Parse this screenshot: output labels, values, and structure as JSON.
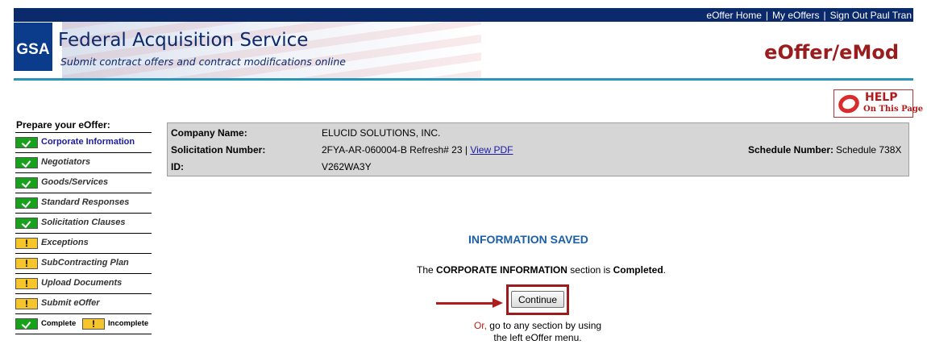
{
  "topnav": {
    "links": [
      "eOffer Home",
      "My eOffers",
      "Sign Out Paul Tran"
    ],
    "separator": "|"
  },
  "header": {
    "logo_text": "GSA",
    "title": "Federal Acquisition Service",
    "subtitle": "Submit contract offers and contract modifications online",
    "app_name": "eOffer/eMod"
  },
  "help": {
    "line1": "HELP",
    "line2": "On This Page"
  },
  "menu": {
    "title": "Prepare your eOffer:",
    "items": [
      {
        "label": "Corporate Information",
        "status": "complete",
        "active": true
      },
      {
        "label": "Negotiators",
        "status": "complete",
        "active": false
      },
      {
        "label": "Goods/Services",
        "status": "complete",
        "active": false
      },
      {
        "label": "Standard Responses",
        "status": "complete",
        "active": false
      },
      {
        "label": "Solicitation Clauses",
        "status": "complete",
        "active": false
      },
      {
        "label": "Exceptions",
        "status": "incomplete",
        "active": false
      },
      {
        "label": "SubContracting Plan",
        "status": "incomplete",
        "active": false
      },
      {
        "label": "Upload Documents",
        "status": "incomplete",
        "active": false
      },
      {
        "label": "Submit eOffer",
        "status": "incomplete",
        "active": false
      }
    ],
    "legend": {
      "complete": "Complete",
      "incomplete": "Incomplete"
    }
  },
  "info": {
    "company_label": "Company Name:",
    "company_value": "ELUCID SOLUTIONS, INC.",
    "solicitation_label": "Solicitation Number:",
    "solicitation_value": "2FYA-AR-060004-B Refresh# 23 |",
    "view_pdf": "View PDF",
    "schedule_label": "Schedule Number:",
    "schedule_value": "Schedule 738X",
    "id_label": "ID:",
    "id_value": "V262WA3Y"
  },
  "saved": {
    "title": "INFORMATION SAVED",
    "msg_prefix": "The",
    "msg_section": "CORPORATE INFORMATION",
    "msg_mid": "section is",
    "msg_status": "Completed",
    "msg_end": ".",
    "continue_label": "Continue",
    "or_text": "Or,",
    "note_rest": "go to any section by using",
    "note_line2": "the left eOffer menu."
  },
  "colors": {
    "topbar": "#0b2a6b",
    "app_title": "#9b1c1c",
    "rule": "#2b95b8",
    "complete": "#18a21b",
    "incomplete": "#f6c52b",
    "saved_title": "#1b5fa8"
  }
}
